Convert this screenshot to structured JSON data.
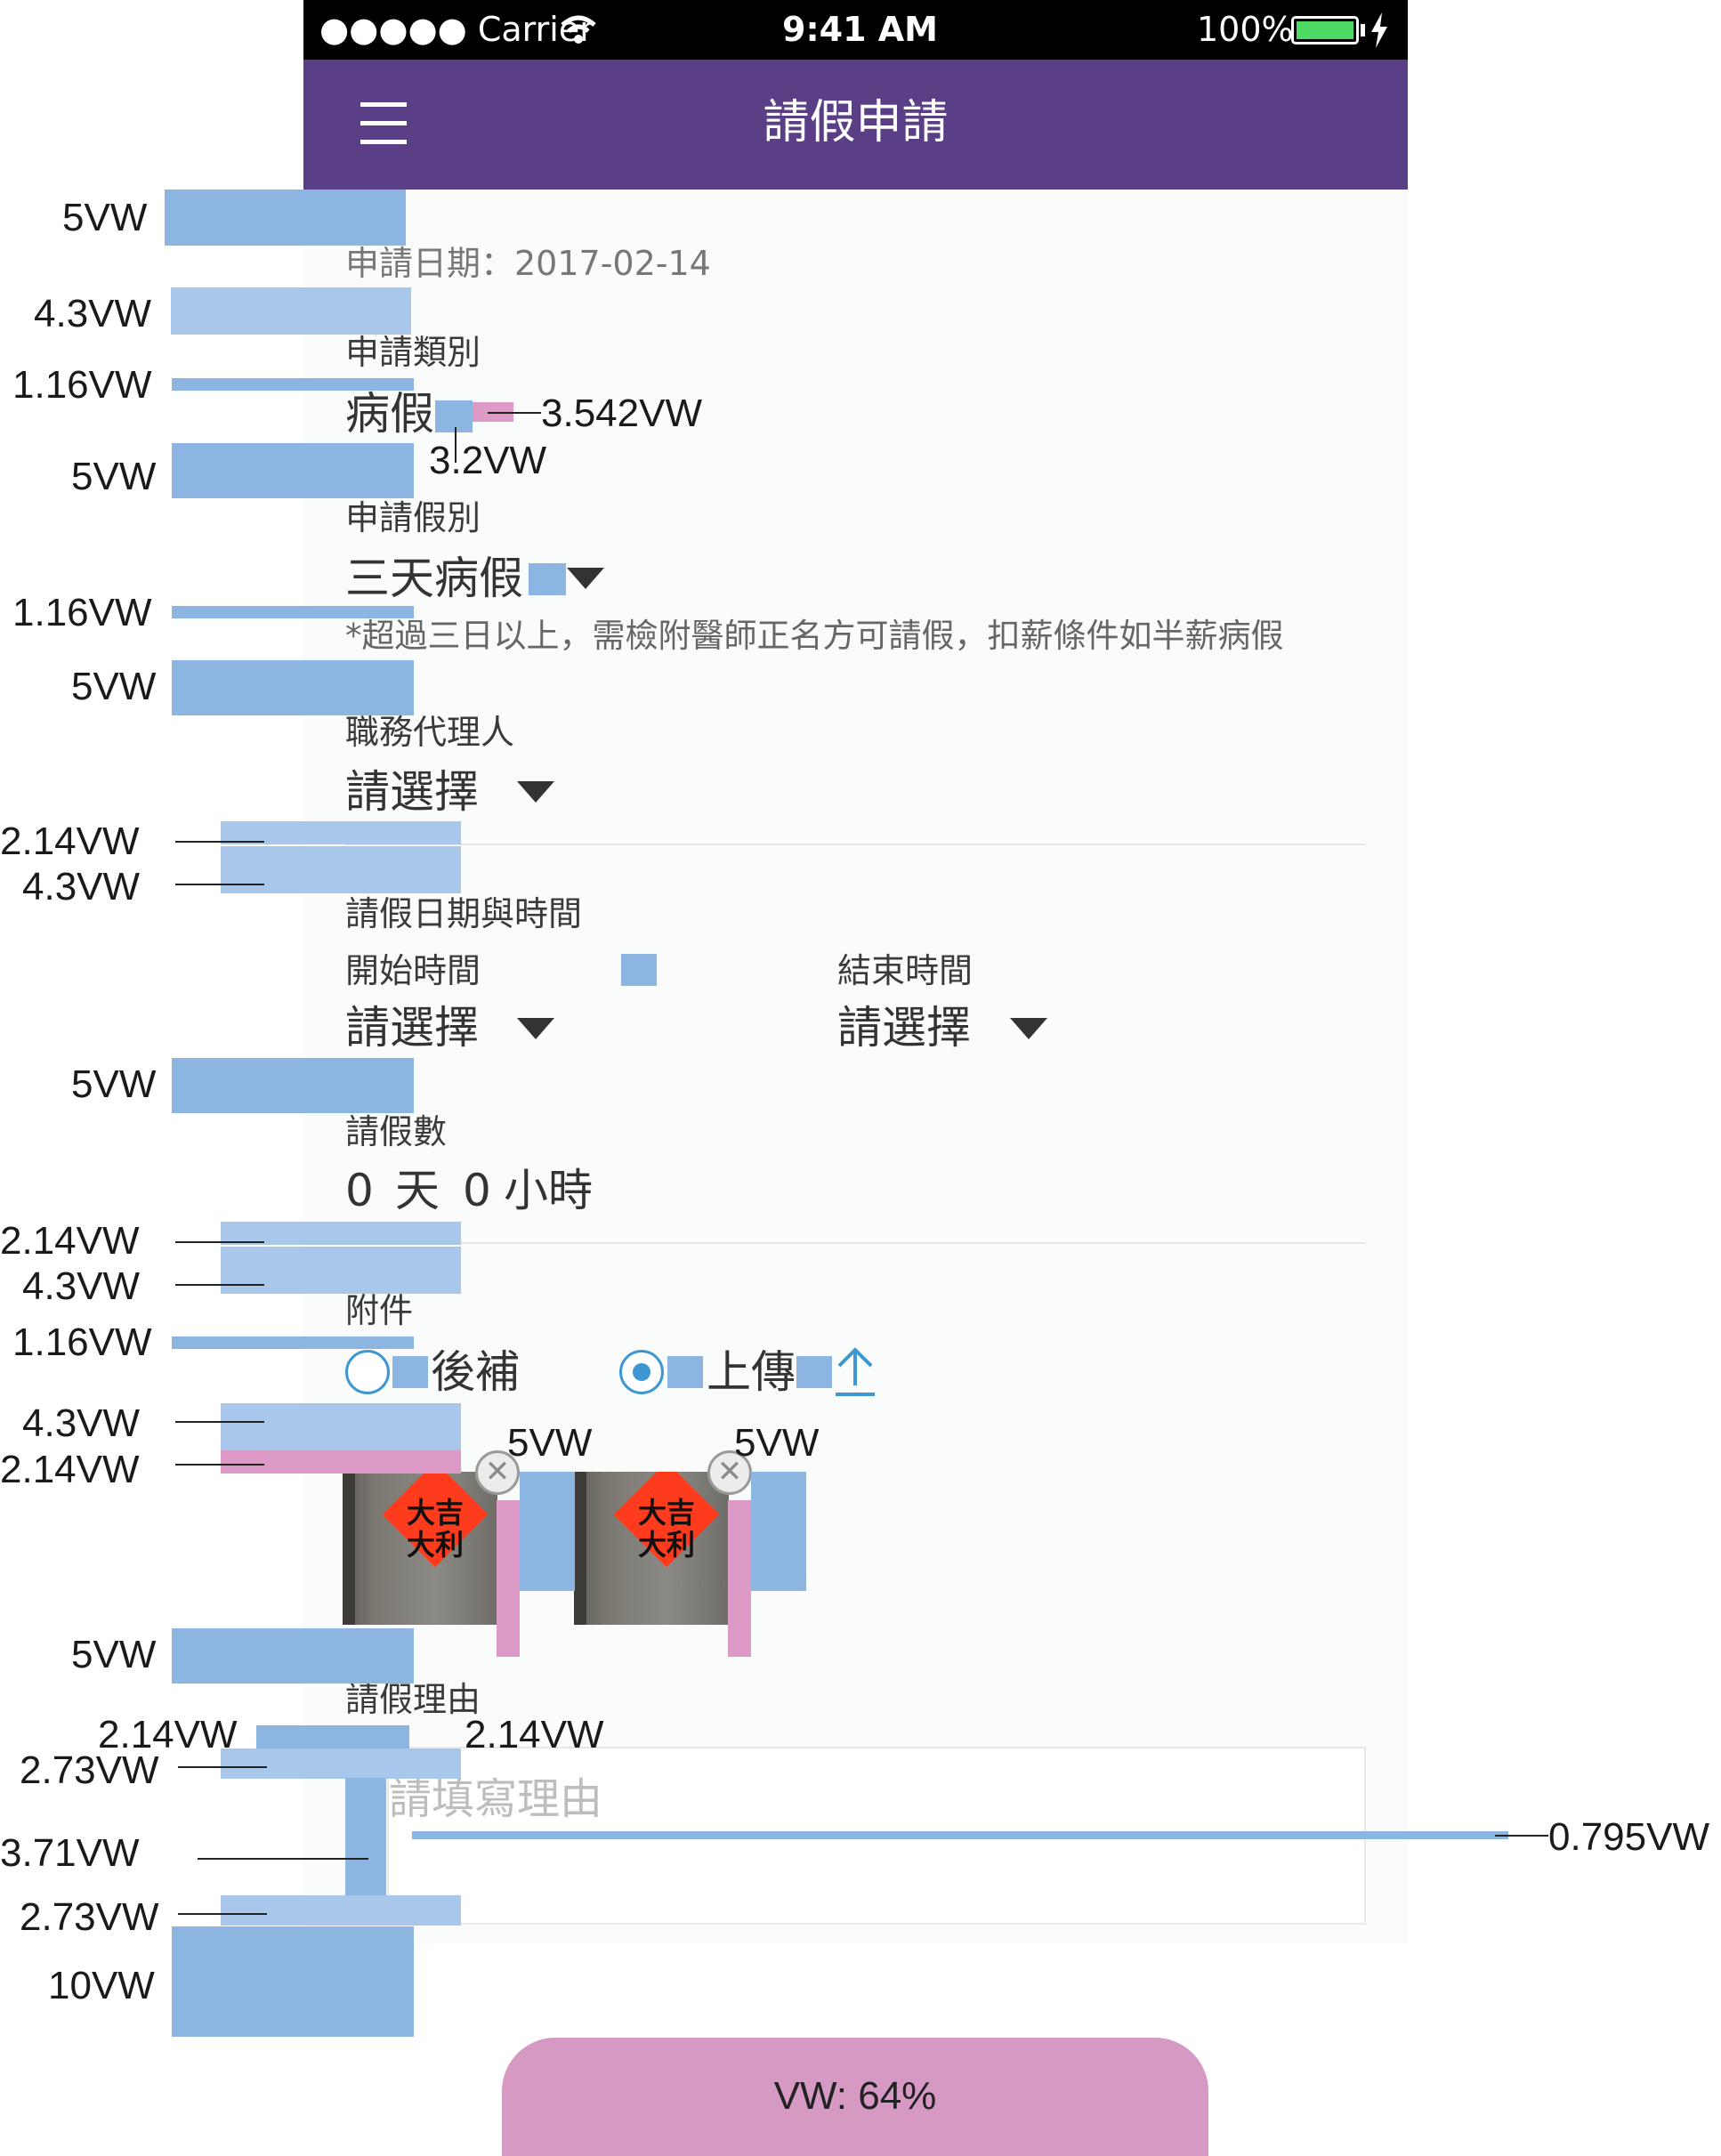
{
  "status_bar": {
    "carrier": "●●●●● Carrier",
    "time": "9:41 AM",
    "battery": "100%",
    "colors": {
      "background": "#000000",
      "battery": "#4cd964"
    }
  },
  "app_bar": {
    "title": "請假申請",
    "menu_icon": "hamburger-menu-icon",
    "color": "#5a3f87"
  },
  "form": {
    "apply_date": "申請日期：2017-02-14",
    "category": {
      "label": "申請類別",
      "value": "病假"
    },
    "leave_type": {
      "label": "申請假別",
      "value": "三天病假",
      "note": "*超過三日以上，需檢附醫師正名方可請假，扣薪條件如半薪病假"
    },
    "agent": {
      "label": "職務代理人",
      "value": "請選擇"
    },
    "datetime": {
      "section_label": "請假日期與時間",
      "start_label": "開始時間",
      "start_value": "請選擇",
      "end_label": "結束時間",
      "end_value": "請選擇"
    },
    "duration": {
      "label": "請假數",
      "days": "0",
      "days_unit": "天",
      "hours": "0",
      "hours_unit": "小時"
    },
    "attachment": {
      "label": "附件",
      "option_later": "後補",
      "option_upload": "上傳",
      "selected": "上傳",
      "upload_icon": "upload-arrow-icon",
      "thumbnail_text": "大吉大利"
    },
    "reason": {
      "label": "請假理由",
      "placeholder": "請填寫理由"
    }
  },
  "annotations": {
    "left": [
      "5VW",
      "4.3VW",
      "1.16VW",
      "5VW",
      "1.16VW",
      "5VW",
      "2.14VW",
      "4.3VW",
      "5VW",
      "2.14VW",
      "4.3VW",
      "1.16VW",
      "4.3VW",
      "2.14VW",
      "5VW",
      "2.14VW",
      "2.73VW",
      "3.71VW",
      "2.73VW",
      "10VW"
    ],
    "category_gap": "3.542VW",
    "category_gap2": "3.2VW",
    "thumb_gap_1": "5VW",
    "thumb_gap_2": "5VW",
    "reason_gap": "2.14VW",
    "textarea_line": "0.795VW",
    "button_label": "VW: 64%"
  },
  "colors": {
    "annotation_blue": "#8cb5e2",
    "annotation_pink": "#dd9ac7",
    "radio_blue": "#3e96d2"
  }
}
